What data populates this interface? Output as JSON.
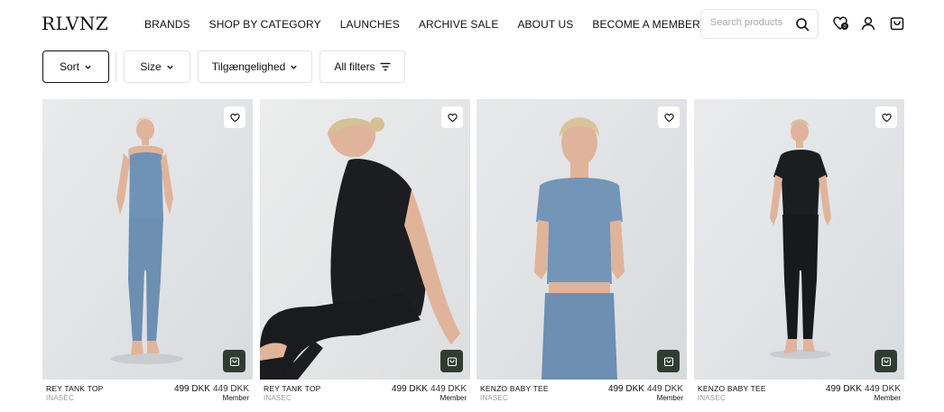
{
  "header": {
    "logo": "RLVNZ",
    "nav": [
      "BRANDS",
      "SHOP BY CATEGORY",
      "LAUNCHES",
      "ARCHIVE SALE",
      "ABOUT US",
      "BECOME A MEMBER"
    ],
    "search": {
      "placeholder": "Search products"
    },
    "wishlist_count": "0"
  },
  "filters": {
    "sort": "Sort",
    "size": "Size",
    "availability": "Tilgængelighed",
    "all": "All filters"
  },
  "products": [
    {
      "name": "REY TANK TOP",
      "brand": "INASEC",
      "price": "499 DKK",
      "member_price": "449 DKK",
      "member_label": "Member"
    },
    {
      "name": "REY TANK TOP",
      "brand": "INASEC",
      "price": "499 DKK",
      "member_price": "449 DKK",
      "member_label": "Member"
    },
    {
      "name": "KENZO BABY TEE",
      "brand": "INASEC",
      "price": "499 DKK",
      "member_price": "449 DKK",
      "member_label": "Member"
    },
    {
      "name": "KENZO BABY TEE",
      "brand": "INASEC",
      "price": "499 DKK",
      "member_price": "449 DKK",
      "member_label": "Member"
    }
  ],
  "colors": {
    "cart_button": "#2f3d31",
    "photo_background": "#e4e6e8",
    "garment_blue": "#6f93b6",
    "garment_black": "#1c1d20",
    "skin": "#e0b49a"
  }
}
